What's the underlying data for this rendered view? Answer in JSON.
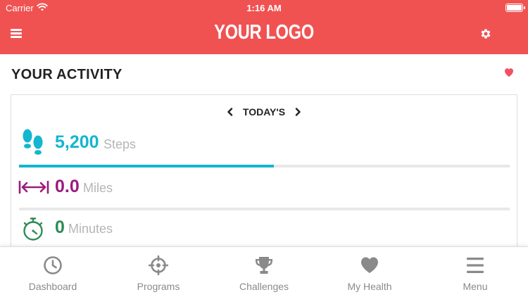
{
  "status_bar": {
    "carrier": "Carrier",
    "time": "1:16 AM",
    "wifi_icon": "wifi-icon",
    "battery_icon": "battery-icon"
  },
  "header": {
    "logo": "YOUR LOGO",
    "background_color": "#f05252",
    "menu_icon": "hamburger-icon",
    "settings_icon": "gear-icon"
  },
  "activity": {
    "title": "YOUR ACTIVITY",
    "favorite_icon": "heart-icon",
    "favorite_color": "#f05263",
    "day_nav": {
      "label": "TODAY'S",
      "prev_icon": "chevron-left-icon",
      "next_icon": "chevron-right-icon"
    },
    "metrics": [
      {
        "name": "steps",
        "value": "5,200",
        "unit": "Steps",
        "icon": "footsteps-icon",
        "color": "#14b6d0",
        "progress": 0.52
      },
      {
        "name": "miles",
        "value": "0.0",
        "unit": "Miles",
        "icon": "distance-arrows-icon",
        "color": "#9b1b7c",
        "progress": 0
      },
      {
        "name": "minutes",
        "value": "0",
        "unit": "Minutes",
        "icon": "stopwatch-icon",
        "color": "#2e8b57"
      }
    ]
  },
  "tabs": [
    {
      "label": "Dashboard",
      "icon": "clock-icon"
    },
    {
      "label": "Programs",
      "icon": "crosshair-icon"
    },
    {
      "label": "Challenges",
      "icon": "trophy-icon"
    },
    {
      "label": "My Health",
      "icon": "heart-icon"
    },
    {
      "label": "Menu",
      "icon": "menu-lines-icon"
    }
  ],
  "colors": {
    "tab_inactive": "#8a8a8a",
    "unit_text": "#b5b5b5"
  }
}
